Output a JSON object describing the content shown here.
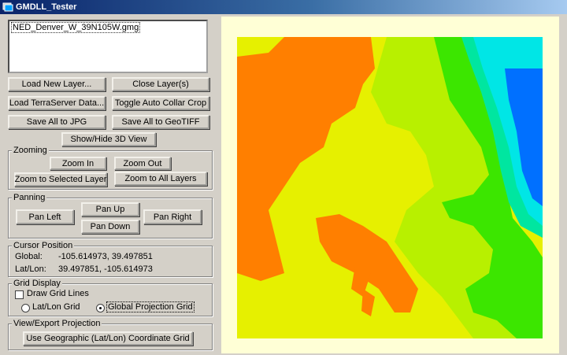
{
  "window": {
    "title": "GMDLL_Tester",
    "app_icon": "windows-app-icon"
  },
  "layers": {
    "items": [
      "NED_Denver_W_39N105W.gmg"
    ]
  },
  "buttons": {
    "load_new_layer": "Load New Layer...",
    "close_layers": "Close Layer(s)",
    "load_terraserver": "Load TerraServer Data...",
    "toggle_collar": "Toggle Auto Collar Crop",
    "save_jpg": "Save All to JPG",
    "save_geotiff": "Save All to GeoTIFF",
    "show_3d": "Show/Hide 3D View"
  },
  "zooming": {
    "legend": "Zooming",
    "zoom_in": "Zoom In",
    "zoom_out": "Zoom Out",
    "zoom_selected": "Zoom to Selected Layer",
    "zoom_all": "Zoom to All Layers"
  },
  "panning": {
    "legend": "Panning",
    "pan_left": "Pan Left",
    "pan_up": "Pan Up",
    "pan_down": "Pan Down",
    "pan_right": "Pan Right"
  },
  "cursor": {
    "legend": "Cursor Position",
    "global_label": "Global:",
    "global_value": "-105.614973, 39.497851",
    "latlon_label": "Lat/Lon:",
    "latlon_value": "39.497851, -105.614973"
  },
  "grid": {
    "legend": "Grid Display",
    "draw_lines": "Draw Grid Lines",
    "draw_lines_checked": false,
    "latlon_grid": "Lat/Lon Grid",
    "global_grid": "Global Projection Grid",
    "selected": "global"
  },
  "export": {
    "legend": "View/Export Projection",
    "use_geo": "Use Geographic (Lat/Lon) Coordinate Grid"
  },
  "map": {
    "background": "#ffffd6",
    "colors": {
      "orange": "#ff7f00",
      "yellow": "#e6f000",
      "yellow_green": "#b8f000",
      "green": "#3ce600",
      "teal": "#00e6a0",
      "cyan": "#00e6e6",
      "blue": "#0070ff"
    }
  }
}
